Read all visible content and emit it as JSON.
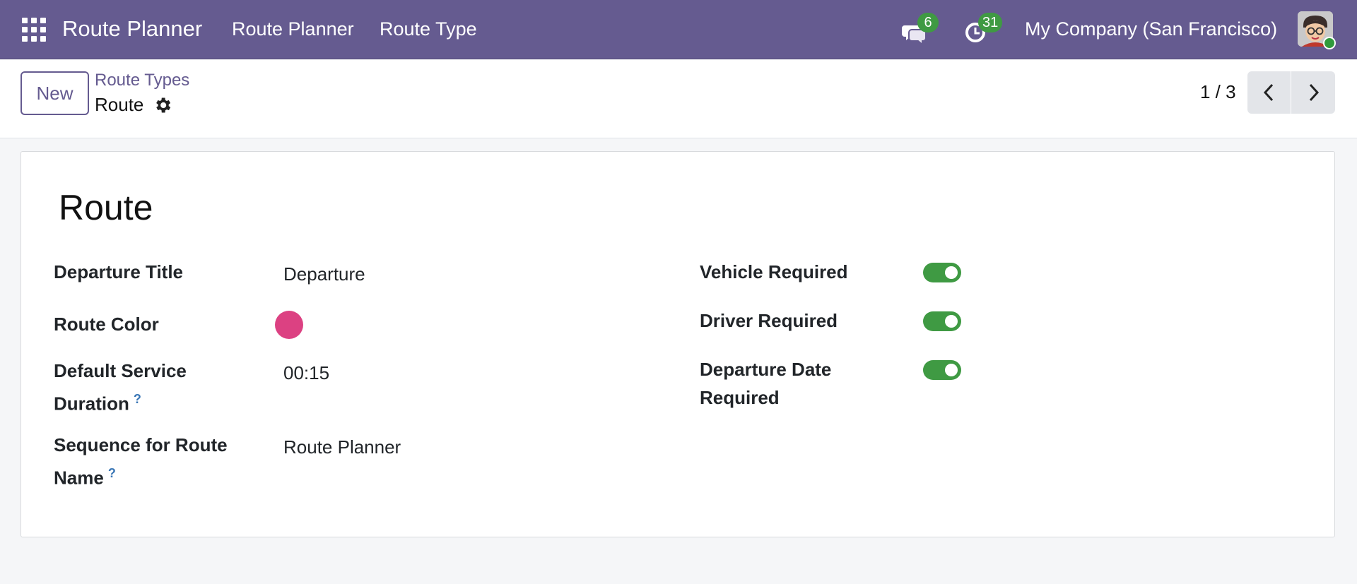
{
  "navbar": {
    "app_title": "Route Planner",
    "menu": [
      "Route Planner",
      "Route Type"
    ],
    "messages_count": "6",
    "activities_count": "31",
    "company": "My Company (San Francisco)",
    "icons": [
      "apps-grid-icon",
      "chat-icon",
      "clock-icon",
      "avatar"
    ]
  },
  "control": {
    "new_label": "New",
    "breadcrumb_parent": "Route Types",
    "breadcrumb_current": "Route",
    "pager_value": "1 / 3"
  },
  "form": {
    "title": "Route",
    "left_fields": [
      {
        "label": "Departure Title",
        "value": "Departure"
      },
      {
        "label": "Route Color",
        "value": ""
      },
      {
        "label_line1": "Default Service",
        "label_line2": "Duration",
        "help": "?",
        "value": "00:15"
      },
      {
        "label_line1": "Sequence for Route",
        "label_line2": "Name",
        "help": "?",
        "value": "Route Planner"
      }
    ],
    "right_fields": [
      {
        "label": "Vehicle Required",
        "enabled": true
      },
      {
        "label": "Driver Required",
        "enabled": true
      },
      {
        "label_line1": "Departure Date",
        "label_line2": "Required",
        "enabled": true
      }
    ],
    "route_color_hex": "#dc4182"
  },
  "colors": {
    "navbar": "#655b90",
    "toggle_on": "#3f9a43",
    "badge": "#3f9a43"
  }
}
